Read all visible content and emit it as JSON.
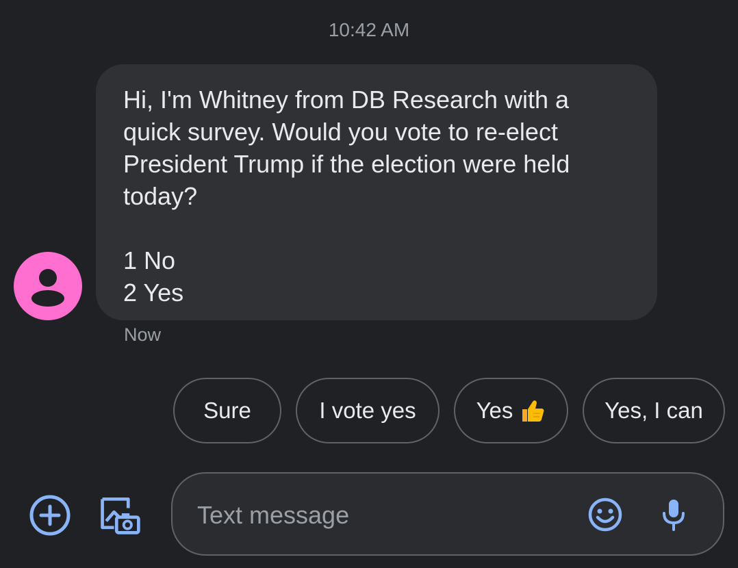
{
  "header": {
    "time": "10:42 AM"
  },
  "conversation": {
    "message": {
      "lines": [
        "Hi, I'm Whitney from DB Research with a",
        "quick survey. Would you vote to re-elect",
        "President Trump if the election were held",
        "today?"
      ],
      "options": [
        "1 No",
        "2 Yes"
      ],
      "time": "Now"
    },
    "avatar": {
      "icon": "person-icon",
      "color": "#ff6fcf"
    }
  },
  "smart_replies": [
    {
      "label": "Sure"
    },
    {
      "label": "I vote yes"
    },
    {
      "label": "Yes",
      "emoji": "thumbs-up-icon"
    },
    {
      "label": "Yes, I can"
    }
  ],
  "composer": {
    "placeholder": "Text message",
    "icons": [
      "add-icon",
      "gallery-camera-icon",
      "emoji-icon",
      "microphone-icon"
    ]
  },
  "colors": {
    "background": "#202124",
    "bubble": "#303134",
    "accent": "#8ab4f8",
    "thumbs": "#fbbc04"
  }
}
